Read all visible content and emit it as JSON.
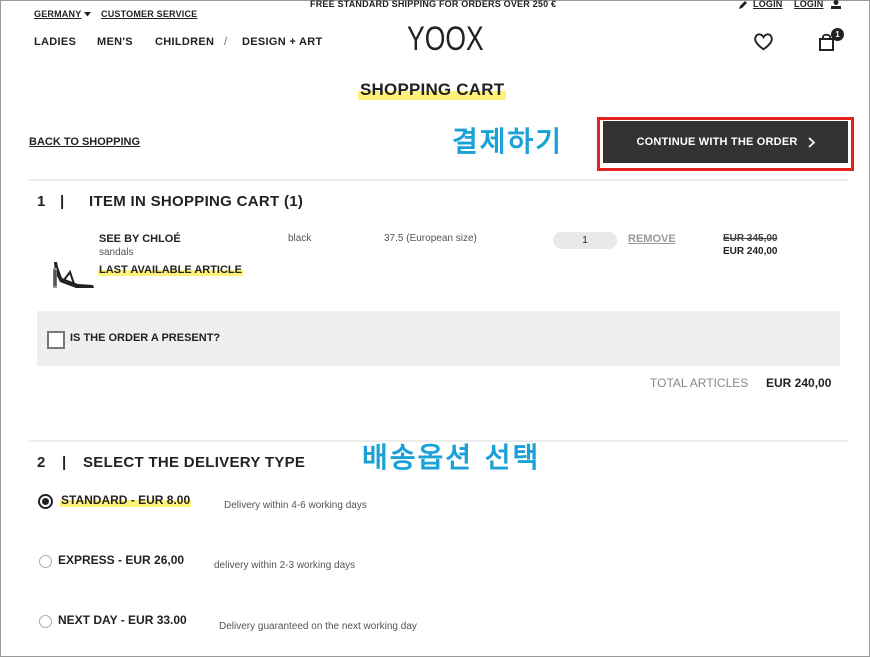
{
  "topbar": {
    "country": "GERMANY",
    "customer_service": "CUSTOMER SERVICE",
    "shipping_notice": "FREE STANDARD SHIPPING FOR ORDERS OVER 250 €",
    "login_1": "LOGIN",
    "login_2": "LOGIN"
  },
  "nav": {
    "ladies": "LADIES",
    "mens": "MEN'S",
    "children": "CHILDREN",
    "separator": "/",
    "design_art": "DESIGN + ART",
    "logo": "YOOX",
    "cart_count": "1"
  },
  "page": {
    "title": "SHOPPING CART",
    "back_link": "BACK TO SHOPPING",
    "continue_button": "CONTINUE WITH THE ORDER"
  },
  "annotations": {
    "checkout": "결제하기",
    "delivery_option": "배송옵션 선택"
  },
  "cart_section": {
    "number": "1",
    "separator": "|",
    "title": "ITEM IN SHOPPING CART (1)",
    "item": {
      "brand": "SEE BY CHLOÉ",
      "category": "sandals",
      "availability": "LAST AVAILABLE ARTICLE",
      "color": "black",
      "size": "37.5 (European size)",
      "quantity": "1",
      "remove": "REMOVE",
      "original_price": "EUR 345,00",
      "price": "EUR 240,00"
    },
    "present_label": "IS THE ORDER A PRESENT?",
    "total_label": "TOTAL ARTICLES",
    "total_value": "EUR 240,00"
  },
  "delivery_section": {
    "number": "2",
    "separator": "|",
    "title": "SELECT THE DELIVERY TYPE",
    "options": [
      {
        "label": "STANDARD - EUR 8.00",
        "desc": "Delivery within 4-6 working days",
        "selected": true
      },
      {
        "label": "EXPRESS - EUR 26,00",
        "desc": "delivery within 2-3 working days",
        "selected": false
      },
      {
        "label": "NEXT DAY - EUR 33.00",
        "desc": "Delivery guaranteed on the next working day",
        "selected": false
      }
    ]
  }
}
